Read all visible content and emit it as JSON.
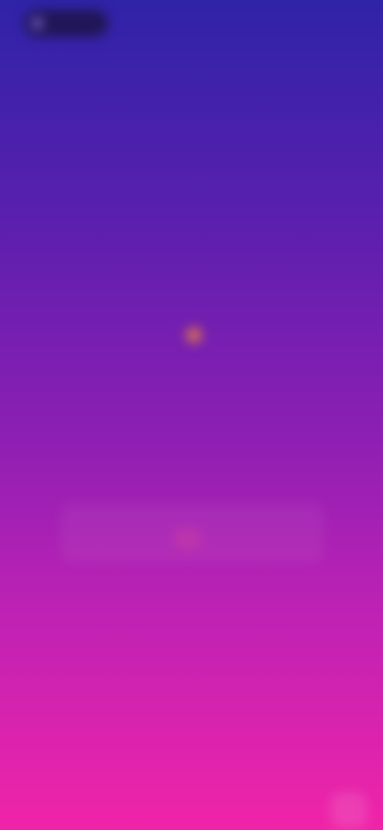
{
  "app": {
    "logo_text": "",
    "logo_icon": "brand-logo-icon"
  },
  "hero": {
    "eyebrow": "",
    "title_line1": "",
    "title_line2": "",
    "accent_icon": "emoji-icon"
  },
  "subtitle": "",
  "cta": {
    "label": ""
  },
  "form": {
    "submit_icon": "submit-icon"
  },
  "corner": {
    "icon": "chat-bubble-icon"
  },
  "colors": {
    "gradient_top": "#2f23a8",
    "gradient_bottom": "#f024a8",
    "accent": "#f08a3a"
  }
}
